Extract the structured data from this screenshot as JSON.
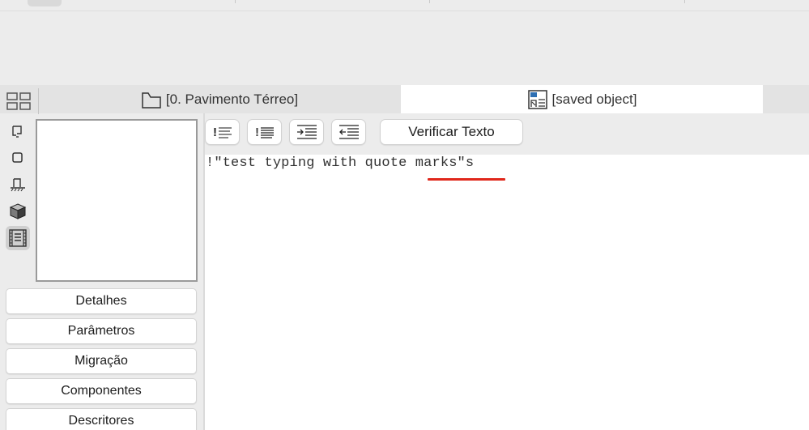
{
  "tabs": [
    {
      "label": "[0. Pavimento Térreo]",
      "icon": "floor-plan-icon",
      "active": false
    },
    {
      "label": "[saved object]",
      "icon": "object-editor-icon",
      "active": true
    }
  ],
  "tools": [
    {
      "icon": "2d-symbol-icon",
      "active": false
    },
    {
      "icon": "front-view-icon",
      "active": false
    },
    {
      "icon": "side-view-icon",
      "active": false
    },
    {
      "icon": "3d-view-icon",
      "active": false
    },
    {
      "icon": "script-icon",
      "active": true
    }
  ],
  "sections": [
    "Detalhes",
    "Parâmetros",
    "Migração",
    "Componentes",
    "Descritores"
  ],
  "toolbar": {
    "format_buttons": [
      "comment-icon",
      "uncomment-icon",
      "indent-icon",
      "outdent-icon"
    ],
    "check_text_label": "Verificar Texto"
  },
  "editor": {
    "content": "!\"test typing with quote marks\"s",
    "misspelled_word": "marks\"s"
  },
  "colors": {
    "spellcheck_underline": "#e0271b",
    "active_tab_bg": "#ffffff",
    "window_bg": "#ececec"
  }
}
